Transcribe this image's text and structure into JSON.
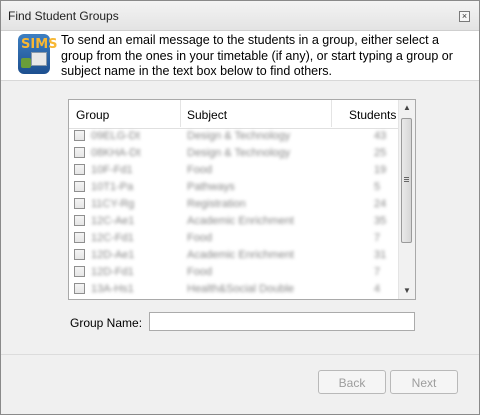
{
  "window": {
    "title": "Find Student Groups",
    "close_glyph": "⊠",
    "logo_text": "SIMS"
  },
  "banner": {
    "text": "To send an email message to the students in a group, either select a group from the ones in your timetable (if any), or start typing a group or subject name in the text box below to find others."
  },
  "grid": {
    "columns": [
      "Group",
      "Subject",
      "Students"
    ],
    "rows": [
      {
        "group": "09ELG-Dt",
        "subject": "Design & Technology",
        "students": "43",
        "checked": false
      },
      {
        "group": "08KHA-Dt",
        "subject": "Design & Technology",
        "students": "25",
        "checked": false
      },
      {
        "group": "10F-Fd1",
        "subject": "Food",
        "students": "19",
        "checked": false
      },
      {
        "group": "10T1-Pa",
        "subject": "Pathways",
        "students": "5",
        "checked": false
      },
      {
        "group": "11CY-Rg",
        "subject": "Registration",
        "students": "24",
        "checked": false
      },
      {
        "group": "12C-Ae1",
        "subject": "Academic Enrichment",
        "students": "35",
        "checked": false
      },
      {
        "group": "12C-Fd1",
        "subject": "Food",
        "students": "7",
        "checked": false
      },
      {
        "group": "12D-Ae1",
        "subject": "Academic Enrichment",
        "students": "31",
        "checked": false
      },
      {
        "group": "12D-Fd1",
        "subject": "Food",
        "students": "7",
        "checked": false
      },
      {
        "group": "13A-Hs1",
        "subject": "Health&Social Double",
        "students": "4",
        "checked": false
      }
    ],
    "scroll": {
      "up_icon": "▲",
      "down_icon": "▼"
    }
  },
  "form": {
    "group_name_label": "Group Name:",
    "group_name_value": "",
    "group_name_placeholder": ""
  },
  "buttons": {
    "back": "Back",
    "next": "Next"
  }
}
